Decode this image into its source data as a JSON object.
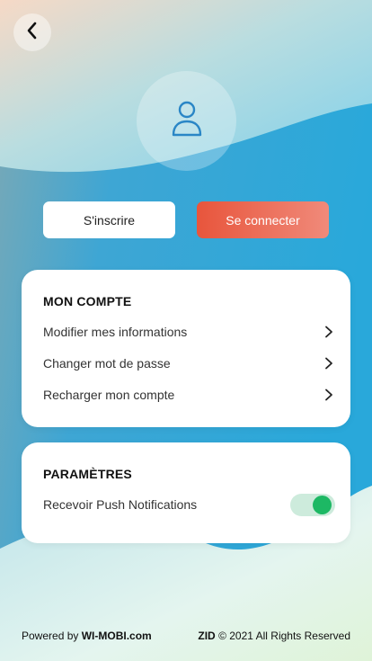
{
  "colors": {
    "primary_gradient_start": "#e8553c",
    "primary_gradient_end": "#f08a7a",
    "icon_blue": "#2a86c6",
    "toggle_on": "#1db864",
    "toggle_track": "#cdebdc"
  },
  "header": {
    "back_icon": "chevron-left-icon",
    "avatar_icon": "user-icon"
  },
  "auth": {
    "register_label": "S'inscrire",
    "login_label": "Se connecter"
  },
  "account": {
    "title": "MON COMPTE",
    "items": [
      {
        "label": "Modifier mes informations",
        "icon": "chevron-right-icon"
      },
      {
        "label": "Changer mot de passe",
        "icon": "chevron-right-icon"
      },
      {
        "label": "Recharger mon compte",
        "icon": "chevron-right-icon"
      }
    ]
  },
  "settings": {
    "title": "PARAMÈTRES",
    "push_label": "Recevoir Push Notifications",
    "push_enabled": true
  },
  "footer": {
    "powered_prefix": "Powered by ",
    "powered_brand": "WI-MOBI.com",
    "copyright_brand": "ZID",
    "copyright_text": " © 2021 All Rights Reserved"
  }
}
